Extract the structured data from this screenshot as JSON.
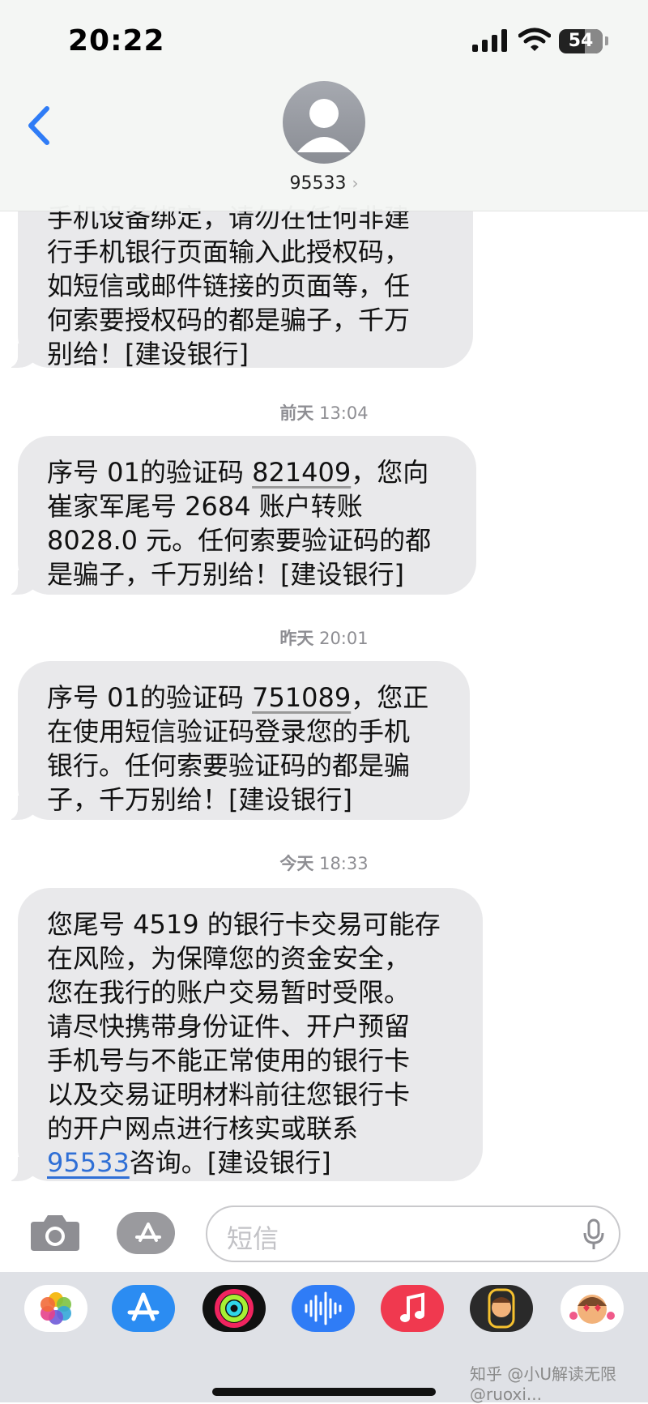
{
  "status_bar": {
    "time": "20:22",
    "battery": "54"
  },
  "header": {
    "contact": "95533",
    "chevron": "›"
  },
  "messages": [
    {
      "lines": [
        "手机设备绑定，请勿在任何非建",
        "行手机银行页面输入此授权码，",
        "如短信或邮件链接的页面等，任",
        "何索要授权码的都是骗子，千万",
        "别给！[建设银行]"
      ]
    },
    {
      "timestamp_day": "前天",
      "timestamp_time": "13:04",
      "l1_pre": "序号 01的验证码 ",
      "l1_code": "821409",
      "l1_post": "，您向",
      "l2": "崔家军尾号 2684 账户转账",
      "l3": "8028.0 元。任何索要验证码的都",
      "l4": "是骗子，千万别给！[建设银行]"
    },
    {
      "timestamp_day": "昨天",
      "timestamp_time": "20:01",
      "l1_pre": "序号 01的验证码 ",
      "l1_code": "751089",
      "l1_post": "，您正",
      "l2": "在使用短信验证码登录您的手机",
      "l3": "银行。任何索要验证码的都是骗",
      "l4": "子，千万别给！[建设银行]"
    },
    {
      "timestamp_day": "今天",
      "timestamp_time": "18:33",
      "lines": [
        "您尾号 4519 的银行卡交易可能存",
        "在风险，为保障您的资金安全，",
        "您在我行的账户交易暂时受限。",
        "请尽快携带身份证件、开户预留",
        "手机号与不能正常使用的银行卡",
        "以及交易证明材料前往您银行卡",
        "的开户网点进行核实或联系"
      ],
      "last_link": "95533",
      "last_post": "咨询。[建设银行]"
    }
  ],
  "composer": {
    "placeholder": "短信"
  },
  "app_drawer": {
    "apps": [
      "photos-app",
      "app-store-app",
      "activity-app",
      "audio-message-app",
      "music-app",
      "memoji-app",
      "memoji-stickers-app"
    ]
  },
  "watermark": "知乎 @小U解读无限 @ruoxi..."
}
